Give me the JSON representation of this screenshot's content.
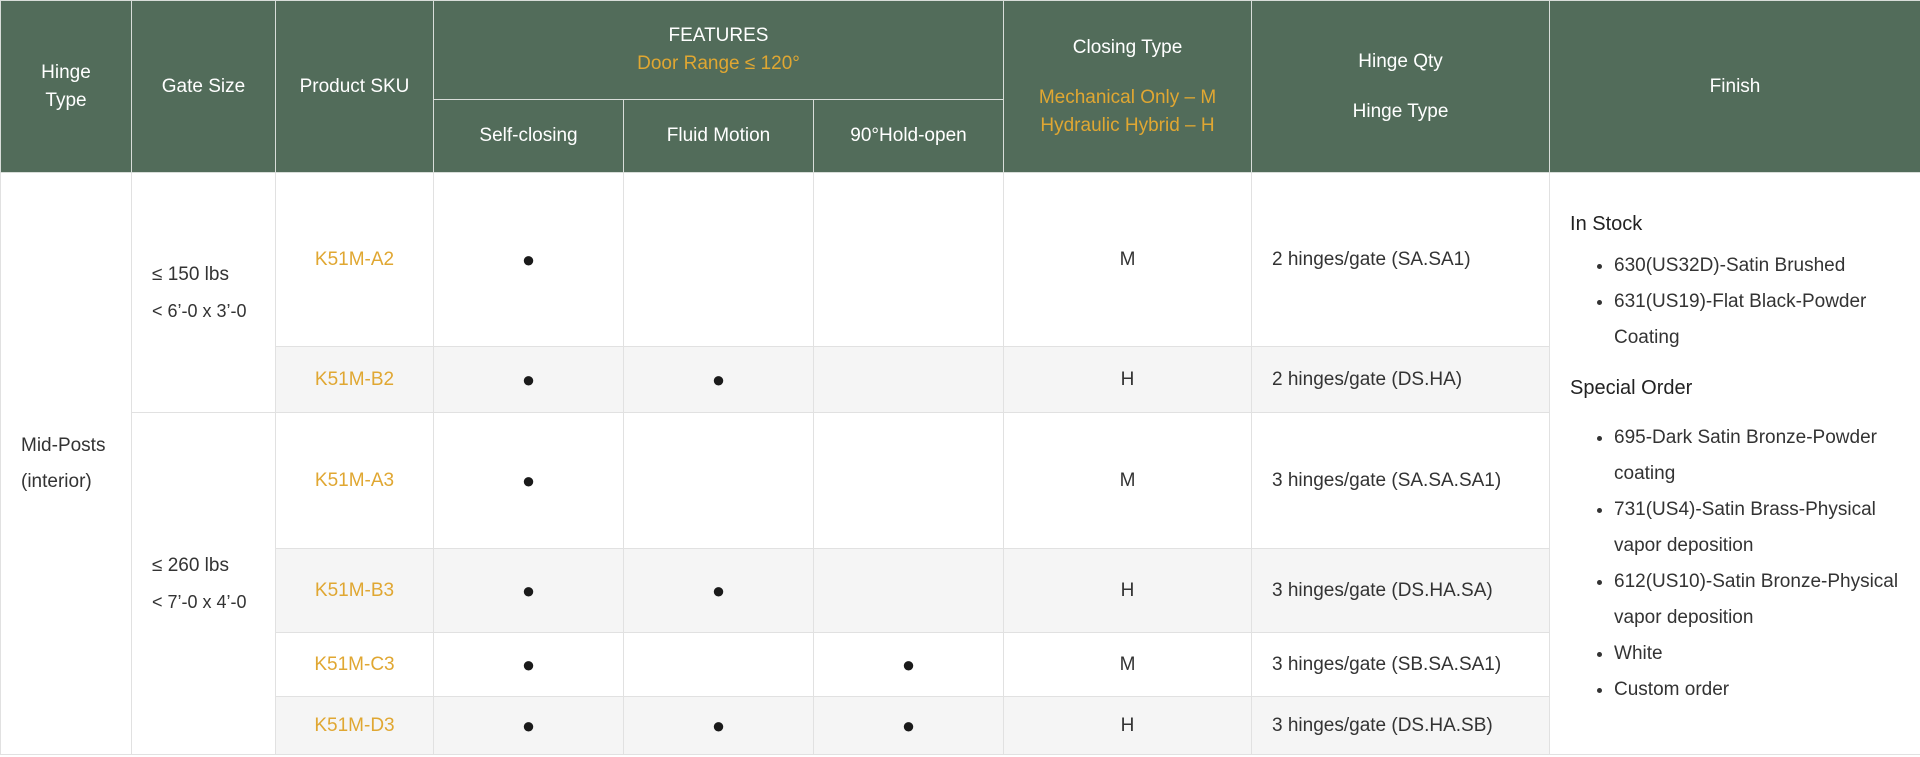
{
  "header": {
    "hinge_type_line1": "Hinge",
    "hinge_type_line2": "Type",
    "gate_size": "Gate Size",
    "product_sku": "Product SKU",
    "features_title": "FEATURES",
    "features_subtitle": "Door Range ≤ 120°",
    "self_closing": "Self-closing",
    "fluid_motion": "Fluid Motion",
    "hold_open": "90°Hold-open",
    "closing_type": "Closing Type",
    "closing_m": "Mechanical Only – M",
    "closing_h": "Hydraulic Hybrid – H",
    "hinge_qty": "Hinge Qty",
    "hinge_qty_type": "Hinge Type",
    "finish": "Finish"
  },
  "hinge_type": {
    "line1": "Mid-Posts",
    "line2": "(interior)"
  },
  "gate_groups": [
    {
      "weight": "≤ 150 lbs",
      "size": "< 6’-0 x 3’-0"
    },
    {
      "weight": "≤ 260 lbs",
      "size": "< 7’-0 x 4’-0"
    }
  ],
  "dot_symbol": "●",
  "rows": [
    {
      "sku": "K51M-A2",
      "self_closing": "●",
      "fluid_motion": "",
      "hold_open": "",
      "closing": "M",
      "qty": "2 hinges/gate (SA.SA1)"
    },
    {
      "sku": "K51M-B2",
      "self_closing": "●",
      "fluid_motion": "●",
      "hold_open": "",
      "closing": "H",
      "qty": "2 hinges/gate (DS.HA)"
    },
    {
      "sku": "K51M-A3",
      "self_closing": "●",
      "fluid_motion": "",
      "hold_open": "",
      "closing": "M",
      "qty": "3 hinges/gate (SA.SA.SA1)"
    },
    {
      "sku": "K51M-B3",
      "self_closing": "●",
      "fluid_motion": "●",
      "hold_open": "",
      "closing": "H",
      "qty": "3 hinges/gate (DS.HA.SA)"
    },
    {
      "sku": "K51M-C3",
      "self_closing": "●",
      "fluid_motion": "",
      "hold_open": "●",
      "closing": "M",
      "qty": "3 hinges/gate (SB.SA.SA1)"
    },
    {
      "sku": "K51M-D3",
      "self_closing": "●",
      "fluid_motion": "●",
      "hold_open": "●",
      "closing": "H",
      "qty": "3 hinges/gate (DS.HA.SB)"
    }
  ],
  "finish": {
    "in_stock_title": "In Stock",
    "in_stock": [
      "630(US32D)-Satin Brushed",
      "631(US19)-Flat Black-Powder Coating"
    ],
    "special_title": "Special Order",
    "special": [
      "695-Dark Satin Bronze-Powder coating",
      "731(US4)-Satin Brass-Physical vapor deposition",
      "612(US10)-Satin Bronze-Physical vapor deposition",
      "White",
      "Custom order"
    ]
  },
  "colors": {
    "header_bg": "#526c5a",
    "accent": "#e0a732",
    "row_shade": "#f5f5f5"
  }
}
